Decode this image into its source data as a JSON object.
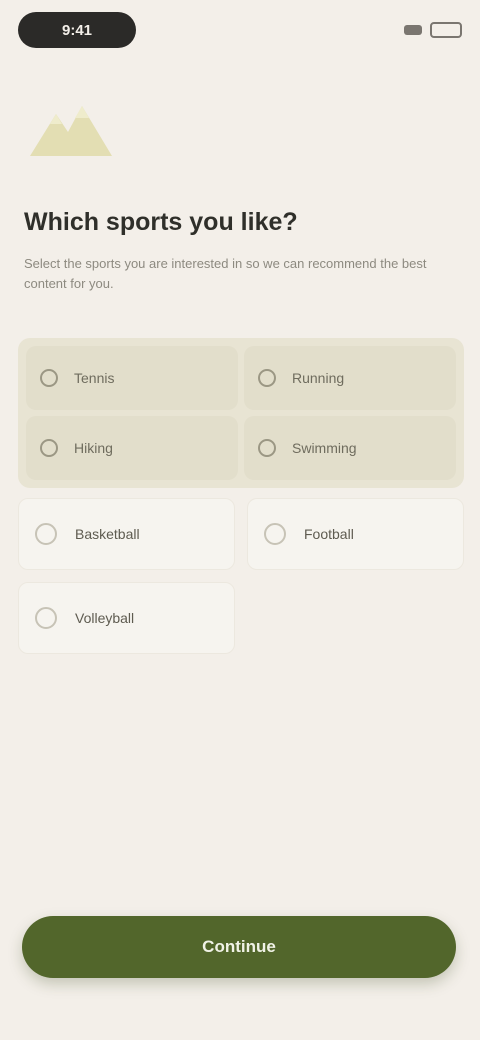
{
  "status": {
    "time": "9:41"
  },
  "screen": {
    "title": "Which sports you like?",
    "subtitle": "Select the sports you are interested in so we can recommend the best content for you."
  },
  "selected": [
    {
      "label": "Tennis"
    },
    {
      "label": "Running"
    },
    {
      "label": "Hiking"
    },
    {
      "label": "Swimming"
    }
  ],
  "options": [
    {
      "label": "Basketball"
    },
    {
      "label": "Football"
    },
    {
      "label": "Volleyball"
    }
  ],
  "cta": {
    "label": "Continue"
  },
  "colors": {
    "accent": "#52662b",
    "background": "#f3efe9",
    "selected_bg": "#e8e4d3"
  },
  "icons": {
    "hero": "mountain-icon"
  }
}
